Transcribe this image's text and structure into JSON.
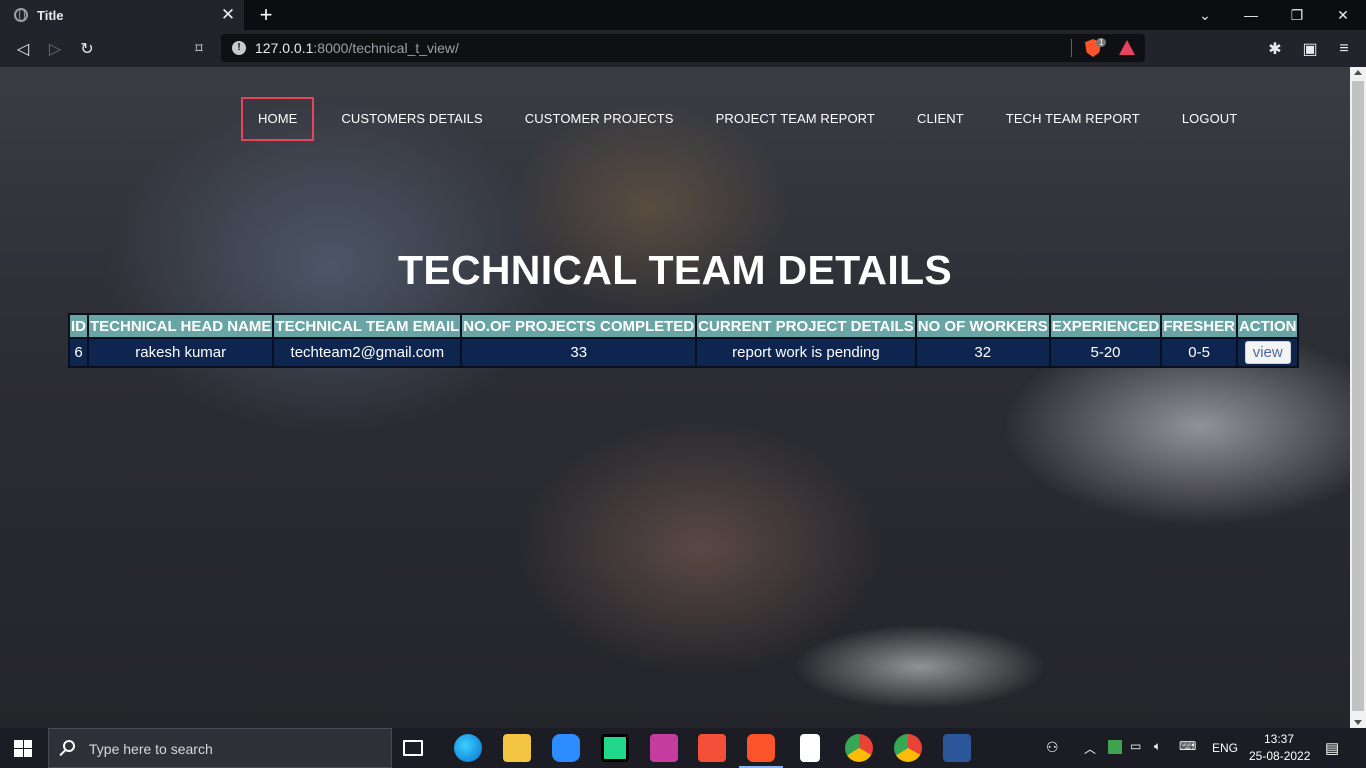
{
  "browser": {
    "tab_title": "Title",
    "url_host": "127.0.0.1",
    "url_rest": ":8000/technical_t_view/",
    "shield_count": "1"
  },
  "nav": {
    "items": [
      {
        "label": "HOME",
        "active": true
      },
      {
        "label": "CUSTOMERS DETAILS"
      },
      {
        "label": "CUSTOMER PROJECTS"
      },
      {
        "label": "PROJECT TEAM REPORT"
      },
      {
        "label": "CLIENT"
      },
      {
        "label": "TECH TEAM REPORT"
      },
      {
        "label": "LOGOUT"
      }
    ]
  },
  "page": {
    "title": "TECHNICAL TEAM DETAILS"
  },
  "table": {
    "headers": [
      "ID",
      "TECHNICAL HEAD NAME",
      "TECHNICAL TEAM EMAIL",
      "NO.OF PROJECTS COMPLETED",
      "CURRENT PROJECT DETAILS",
      "NO OF WORKERS",
      "EXPERIENCED",
      "FRESHER",
      "ACTION"
    ],
    "rows": [
      {
        "id": "6",
        "head_name": "rakesh kumar",
        "email": "techteam2@gmail.com",
        "projects_completed": "33",
        "current_project": "report work is pending",
        "workers": "32",
        "experienced": "5-20",
        "fresher": "0-5",
        "action": "view"
      }
    ]
  },
  "taskbar": {
    "search_placeholder": "Type here to search",
    "language": "ENG",
    "time": "13:37",
    "date": "25-08-2022"
  },
  "colors": {
    "header_bg": "#6aa5a5",
    "row_bg": "#0e2550",
    "active_border": "#e8455a"
  }
}
